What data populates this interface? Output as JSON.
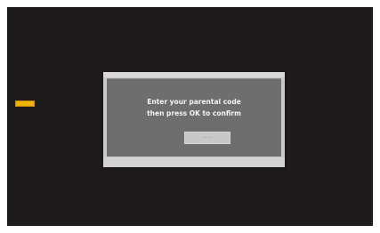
{
  "dialog": {
    "message_line1": "Enter your parental code",
    "message_line2": "then press OK to confirm",
    "code_mask": "----"
  },
  "colors": {
    "screen_bg": "#1c1a1b",
    "dialog_frame": "#c9c9c9",
    "dialog_panel": "#6e6e6e",
    "badge": "#f0b400"
  }
}
